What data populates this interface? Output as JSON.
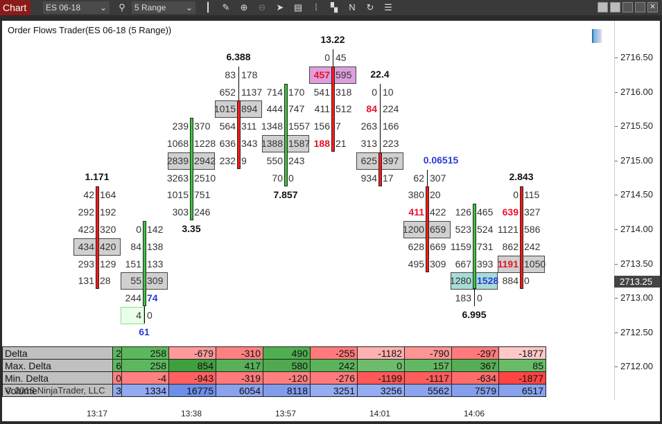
{
  "toolbar": {
    "tab": "Chart",
    "instrument": "ES 06-18",
    "period": "5 Range",
    "icons": [
      "bars-icon",
      "pencil-icon",
      "zoom-in-icon",
      "zoom-out-icon",
      "pointer-icon",
      "data-box-icon",
      "properties-icon",
      "templates-icon",
      "strategy-icon",
      "reload-icon",
      "list-icon"
    ]
  },
  "chart_title": "Order Flows Trader(ES 06-18 (5 Range))",
  "copyright": "© 2018 NinjaTrader, LLC",
  "price_axis": [
    "2716.50",
    "2716.00",
    "2715.50",
    "2715.00",
    "2714.50",
    "2714.00",
    "2713.50",
    "2713.00",
    "2712.50",
    "2712.00"
  ],
  "current_price": "2713.25",
  "time_axis": [
    "13:17",
    "13:38",
    "13:57",
    "14:01",
    "14:06"
  ],
  "colors": {
    "up": "#3cc43c",
    "down": "#ff1a1a",
    "highlight": "#d0d0d0",
    "poc_purple": "#dda0dd",
    "poc_teal": "#a8dcd8",
    "imbalance_ask": "#e8102a",
    "imbalance_bid": "#2a3ad8"
  },
  "bars": [
    {
      "dir": "down",
      "body": [
        2714.5,
        2713.25
      ],
      "wick": null,
      "label": "1.171",
      "label_pos": "top",
      "label_color": "black",
      "rows": [
        [
          2714.5,
          "42",
          "164"
        ],
        [
          2714.25,
          "292",
          "192"
        ],
        [
          2714.0,
          "423",
          "320"
        ],
        [
          2713.75,
          "434",
          "420",
          "hl"
        ],
        [
          2713.5,
          "293",
          "129"
        ],
        [
          2713.25,
          "131",
          "28"
        ]
      ]
    },
    {
      "dir": "up",
      "body": [
        2714.0,
        2713.0
      ],
      "wick": [
        2714.0,
        2712.75
      ],
      "label": "61",
      "label_pos": "bottom",
      "label_color": "blue",
      "rows": [
        [
          2714.0,
          "0",
          "142"
        ],
        [
          2713.75,
          "84",
          "138"
        ],
        [
          2713.5,
          "151",
          "133"
        ],
        [
          2713.25,
          "55",
          "309",
          "hl"
        ],
        [
          2713.0,
          "244",
          "74",
          "",
          "",
          "blue"
        ],
        [
          2712.75,
          "4",
          "0",
          "green"
        ]
      ]
    },
    {
      "dir": "up",
      "body": [
        2715.5,
        2714.25
      ],
      "wick": null,
      "label": "3.35",
      "label_pos": "bottom",
      "label_color": "black",
      "rows": [
        [
          2715.5,
          "239",
          "370"
        ],
        [
          2715.25,
          "1068",
          "1228"
        ],
        [
          2715.0,
          "2839",
          "2942",
          "hl"
        ],
        [
          2714.75,
          "3263",
          "2510"
        ],
        [
          2714.5,
          "1015",
          "751"
        ],
        [
          2714.25,
          "303",
          "246"
        ]
      ]
    },
    {
      "dir": "down",
      "body": [
        2715.75,
        2715.0
      ],
      "wick": [
        2716.25,
        2715.0
      ],
      "label": "6.388",
      "label_pos": "top",
      "label_color": "black",
      "rows": [
        [
          2716.25,
          "83",
          "178"
        ],
        [
          2716.0,
          "652",
          "1137"
        ],
        [
          2715.75,
          "1015",
          "894",
          "hl"
        ],
        [
          2715.5,
          "564",
          "311"
        ],
        [
          2715.25,
          "636",
          "343"
        ],
        [
          2715.0,
          "232",
          "9"
        ]
      ]
    },
    {
      "dir": "up",
      "body": [
        2716.0,
        2714.75
      ],
      "wick": null,
      "label": "7.857",
      "label_pos": "bottom",
      "label_color": "black",
      "rows": [
        [
          2716.0,
          "714",
          "170"
        ],
        [
          2715.75,
          "444",
          "747"
        ],
        [
          2715.5,
          "1348",
          "1557"
        ],
        [
          2715.25,
          "1388",
          "1587",
          "hl"
        ],
        [
          2715.0,
          "550",
          "243"
        ],
        [
          2714.75,
          "70",
          "0"
        ]
      ]
    },
    {
      "dir": "down",
      "body": [
        2716.25,
        2715.25
      ],
      "wick": [
        2716.5,
        2715.25
      ],
      "label": "13.22",
      "label_pos": "top",
      "label_color": "black",
      "rows": [
        [
          2716.5,
          "0",
          "45"
        ],
        [
          2716.25,
          "457",
          "595",
          "purple",
          "red"
        ],
        [
          2716.0,
          "541",
          "318"
        ],
        [
          2715.75,
          "411",
          "512"
        ],
        [
          2715.5,
          "156",
          "7"
        ],
        [
          2715.25,
          "188",
          "21",
          "",
          "red"
        ]
      ]
    },
    {
      "dir": "down",
      "body": [
        2715.0,
        2714.75
      ],
      "wick": [
        2716.0,
        2714.75
      ],
      "label": "22.4",
      "label_pos": "top",
      "label_color": "black",
      "rows": [
        [
          2716.0,
          "0",
          "10"
        ],
        [
          2715.75,
          "84",
          "224",
          "",
          "red"
        ],
        [
          2715.5,
          "263",
          "166"
        ],
        [
          2715.25,
          "313",
          "223"
        ],
        [
          2715.0,
          "625",
          "397",
          "hl"
        ],
        [
          2714.75,
          "934",
          "17"
        ]
      ]
    },
    {
      "dir": "down",
      "body": [
        2714.5,
        2713.5
      ],
      "wick": [
        2714.75,
        2713.5
      ],
      "label": "0.06515",
      "label_pos": "top",
      "label_color": "blue",
      "rows": [
        [
          2714.75,
          "62",
          "307"
        ],
        [
          2714.5,
          "380",
          "20"
        ],
        [
          2714.25,
          "411",
          "422",
          "",
          "red"
        ],
        [
          2714.0,
          "1200",
          "659",
          "hl"
        ],
        [
          2713.75,
          "628",
          "669"
        ],
        [
          2713.5,
          "495",
          "309"
        ]
      ]
    },
    {
      "dir": "up",
      "body": [
        2714.25,
        2713.25
      ],
      "wick": [
        2714.25,
        2713.0
      ],
      "label": "6.995",
      "label_pos": "bottom",
      "label_color": "black",
      "rows": [
        [
          2714.25,
          "126",
          "465"
        ],
        [
          2714.0,
          "523",
          "524"
        ],
        [
          2713.75,
          "1159",
          "731"
        ],
        [
          2713.5,
          "667",
          "393"
        ],
        [
          2713.25,
          "1280",
          "1528",
          "teal",
          "",
          "blue"
        ],
        [
          2713.0,
          "183",
          "0"
        ]
      ]
    },
    {
      "dir": "down",
      "body": [
        2714.5,
        2713.25
      ],
      "wick": null,
      "label": "2.843",
      "label_pos": "top",
      "label_color": "black",
      "rows": [
        [
          2714.5,
          "0",
          "115"
        ],
        [
          2714.25,
          "639",
          "327",
          "",
          "red"
        ],
        [
          2714.0,
          "1121",
          "586"
        ],
        [
          2713.75,
          "862",
          "242"
        ],
        [
          2713.5,
          "1191",
          "1050",
          "hl",
          "red"
        ],
        [
          2713.25,
          "884",
          "0"
        ]
      ]
    }
  ],
  "stats": {
    "rows": [
      {
        "label": "Delta",
        "partial": "2",
        "values": [
          "258",
          "-679",
          "-310",
          "490",
          "-255",
          "-1182",
          "-790",
          "-297",
          "-1877"
        ],
        "colors": [
          "#5cb85c",
          "#ff9a9a",
          "#ff8080",
          "#4fae4f",
          "#ff7a7a",
          "#ffb0b0",
          "#ff9494",
          "#ff7a7a",
          "#ffc8c8"
        ]
      },
      {
        "label": "Max. Delta",
        "partial": "6",
        "values": [
          "258",
          "854",
          "417",
          "580",
          "242",
          "0",
          "157",
          "367",
          "85"
        ],
        "colors": [
          "#5cb85c",
          "#3e9f3e",
          "#58b058",
          "#50a850",
          "#5ab45a",
          "#6cbc6c",
          "#62b862",
          "#55ae55",
          "#68bc68"
        ]
      },
      {
        "label": "Min. Delta",
        "partial": "0",
        "values": [
          "-4",
          "-943",
          "-319",
          "-120",
          "-276",
          "-1199",
          "-1117",
          "-634",
          "-1877"
        ],
        "colors": [
          "#ff8080",
          "#ff6060",
          "#ff7a7a",
          "#ff7f7f",
          "#ff7a7a",
          "#ff5858",
          "#ff5c5c",
          "#ff6c6c",
          "#ff4444"
        ]
      },
      {
        "label": "Volume",
        "partial": "3",
        "values": [
          "1334",
          "16775",
          "6054",
          "8118",
          "3251",
          "3256",
          "5562",
          "7579",
          "6517"
        ],
        "colors": [
          "#92aaf0",
          "#6e8ee8",
          "#8aa2ee",
          "#829cec",
          "#94acf0",
          "#94acf0",
          "#8ca4ee",
          "#84a0ec",
          "#88a2ee"
        ]
      }
    ]
  }
}
